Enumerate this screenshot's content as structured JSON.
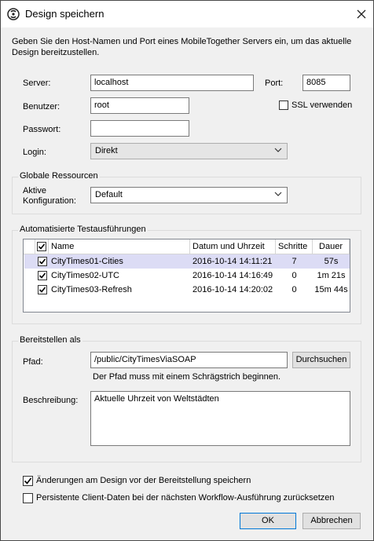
{
  "window": {
    "title": "Design speichern"
  },
  "intro": "Geben Sie den Host-Namen und Port eines MobileTogether Servers ein, um das aktuelle Design bereitzustellen.",
  "server": {
    "server_label": "Server:",
    "server_value": "localhost",
    "port_label": "Port:",
    "port_value": "8085",
    "user_label": "Benutzer:",
    "user_value": "root",
    "ssl_label": "SSL verwenden",
    "ssl_checked": false,
    "password_label": "Passwort:",
    "password_value": "",
    "login_label": "Login:",
    "login_value": "Direkt"
  },
  "global_resources": {
    "title": "Globale Ressourcen",
    "config_label_1": "Aktive",
    "config_label_2": "Konfiguration:",
    "config_value": "Default"
  },
  "tests": {
    "title": "Automatisierte Testausführungen",
    "columns": [
      "Name",
      "Datum und Uhrzeit",
      "Schritte",
      "Dauer"
    ],
    "rows": [
      {
        "name": "CityTimes01-Cities",
        "date": "2016-10-14 14:11:21",
        "steps": "7",
        "duration": "57s",
        "checked": true,
        "selected": true
      },
      {
        "name": "CityTimes02-UTC",
        "date": "2016-10-14 14:16:49",
        "steps": "0",
        "duration": "1m 21s",
        "checked": true,
        "selected": false
      },
      {
        "name": "CityTimes03-Refresh",
        "date": "2016-10-14 14:20:02",
        "steps": "0",
        "duration": "15m 44s",
        "checked": true,
        "selected": false
      }
    ]
  },
  "deploy": {
    "title": "Bereitstellen als",
    "path_label": "Pfad:",
    "path_value": "/public/CityTimesViaSOAP",
    "browse_label": "Durchsuchen",
    "path_hint": "Der Pfad muss mit einem Schrägstrich beginnen.",
    "desc_label": "Beschreibung:",
    "desc_value": "Aktuelle Uhrzeit von Weltstädten"
  },
  "options": {
    "save_changes": "Änderungen am Design vor der Bereitstellung speichern",
    "save_changes_checked": true,
    "reset_client": "Persistente Client-Daten bei der nächsten Workflow-Ausführung zurücksetzen",
    "reset_client_checked": false
  },
  "buttons": {
    "ok": "OK",
    "cancel": "Abbrechen"
  },
  "colors": {
    "selected_row": "#dcdcf5",
    "primary_border": "#0078d7",
    "dialog_bg": "#f0f0f0"
  }
}
